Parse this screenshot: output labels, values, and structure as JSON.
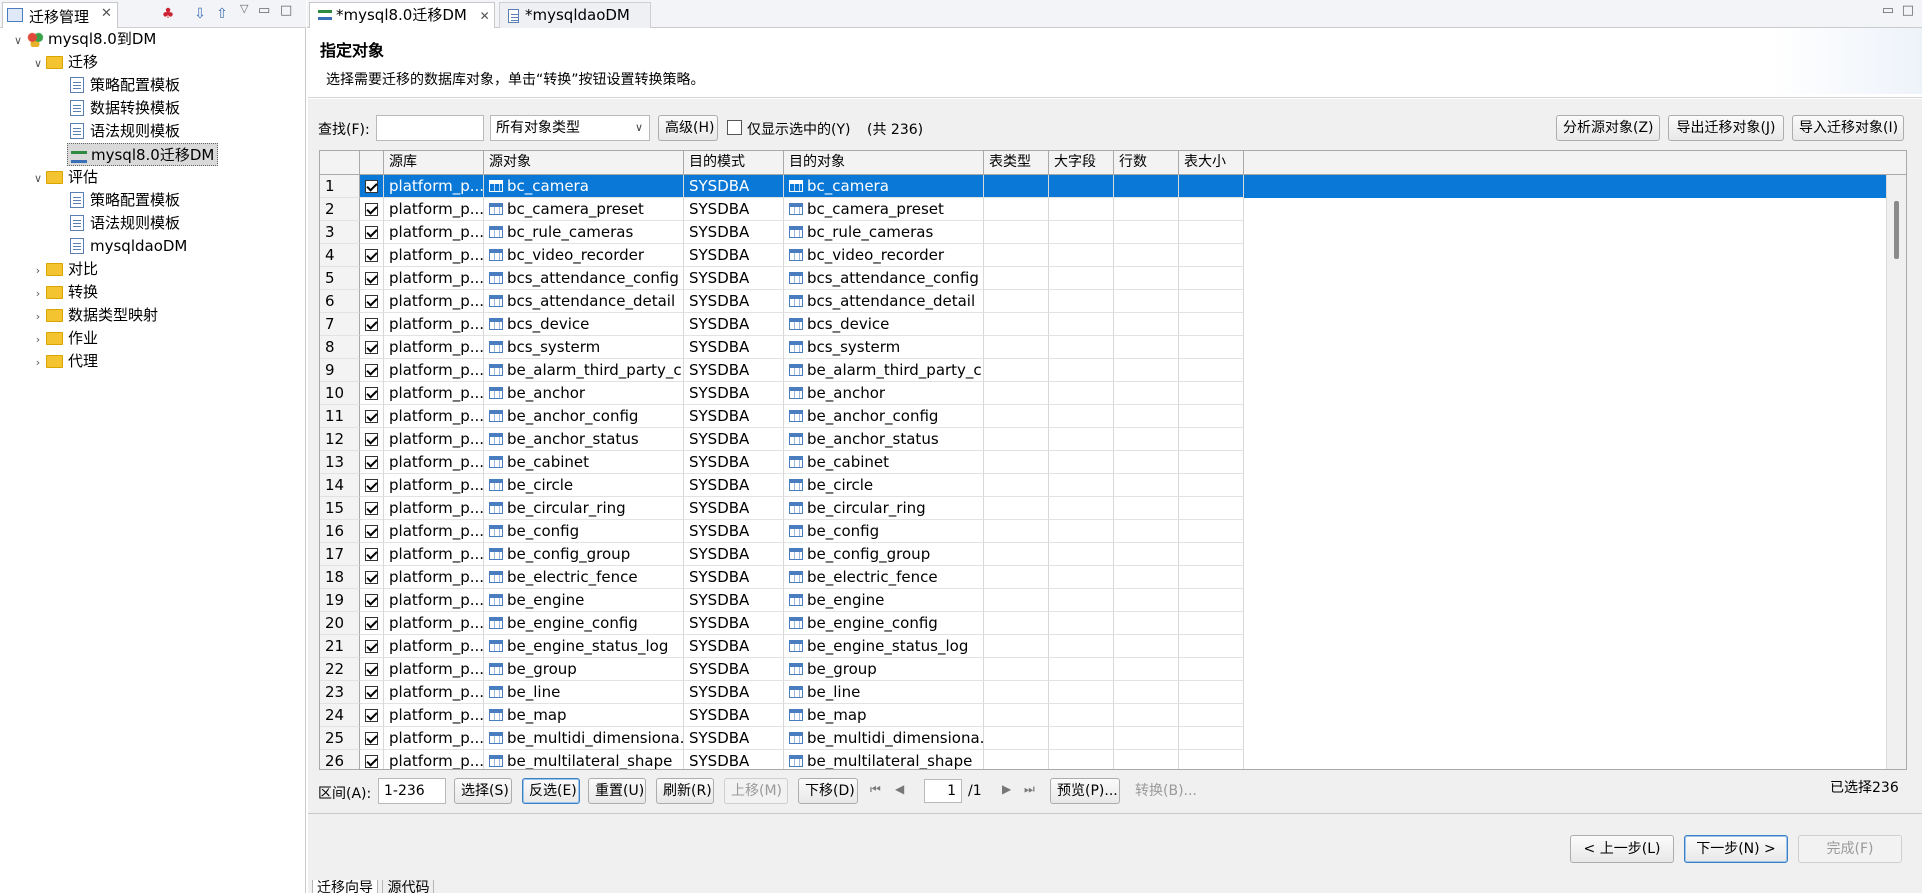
{
  "left_panel": {
    "tab_title": "迁移管理",
    "tree": {
      "root": "mysql8.0到DM",
      "migration_group": "迁移",
      "migration_items": [
        "策略配置模板",
        "数据转换模板",
        "语法规则模板",
        "mysql8.0迁移DM"
      ],
      "evaluation_group": "评估",
      "evaluation_items": [
        "策略配置模板",
        "语法规则模板",
        "mysqldaoDM"
      ],
      "other_groups": [
        "对比",
        "转换",
        "数据类型映射",
        "作业",
        "代理"
      ]
    }
  },
  "editor_tabs": [
    "*mysql8.0迁移DM",
    "*mysqldaoDM"
  ],
  "header": {
    "title": "指定对象",
    "subtitle": "选择需要迁移的数据库对象，单击“转换”按钮设置转换策略。"
  },
  "filter": {
    "find_label": "查找(F):",
    "find_value": "",
    "type_select": "所有对象类型",
    "advanced_button": "高级(H)",
    "only_selected_label": "仅显示选中的(Y)",
    "total": "(共 236)",
    "analyze_button": "分析源对象(Z)",
    "export_button": "导出迁移对象(J)",
    "import_button": "导入迁移对象(I)"
  },
  "table": {
    "columns": [
      "",
      "",
      "源库",
      "源对象",
      "目的模式",
      "目的对象",
      "表类型",
      "大字段",
      "行数",
      "表大小"
    ],
    "rows": [
      {
        "num": "1",
        "src_db": "platform_p...",
        "src_obj": "bc_camera",
        "dst_schema": "SYSDBA",
        "dst_obj": "bc_camera"
      },
      {
        "num": "2",
        "src_db": "platform_p...",
        "src_obj": "bc_camera_preset",
        "dst_schema": "SYSDBA",
        "dst_obj": "bc_camera_preset"
      },
      {
        "num": "3",
        "src_db": "platform_p...",
        "src_obj": "bc_rule_cameras",
        "dst_schema": "SYSDBA",
        "dst_obj": "bc_rule_cameras"
      },
      {
        "num": "4",
        "src_db": "platform_p...",
        "src_obj": "bc_video_recorder",
        "dst_schema": "SYSDBA",
        "dst_obj": "bc_video_recorder"
      },
      {
        "num": "5",
        "src_db": "platform_p...",
        "src_obj": "bcs_attendance_config",
        "dst_schema": "SYSDBA",
        "dst_obj": "bcs_attendance_config"
      },
      {
        "num": "6",
        "src_db": "platform_p...",
        "src_obj": "bcs_attendance_detail",
        "dst_schema": "SYSDBA",
        "dst_obj": "bcs_attendance_detail"
      },
      {
        "num": "7",
        "src_db": "platform_p...",
        "src_obj": "bcs_device",
        "dst_schema": "SYSDBA",
        "dst_obj": "bcs_device"
      },
      {
        "num": "8",
        "src_db": "platform_p...",
        "src_obj": "bcs_systerm",
        "dst_schema": "SYSDBA",
        "dst_obj": "bcs_systerm"
      },
      {
        "num": "9",
        "src_db": "platform_p...",
        "src_obj": "be_alarm_third_party_c...",
        "dst_schema": "SYSDBA",
        "dst_obj": "be_alarm_third_party_c..."
      },
      {
        "num": "10",
        "src_db": "platform_p...",
        "src_obj": "be_anchor",
        "dst_schema": "SYSDBA",
        "dst_obj": "be_anchor"
      },
      {
        "num": "11",
        "src_db": "platform_p...",
        "src_obj": "be_anchor_config",
        "dst_schema": "SYSDBA",
        "dst_obj": "be_anchor_config"
      },
      {
        "num": "12",
        "src_db": "platform_p...",
        "src_obj": "be_anchor_status",
        "dst_schema": "SYSDBA",
        "dst_obj": "be_anchor_status"
      },
      {
        "num": "13",
        "src_db": "platform_p...",
        "src_obj": "be_cabinet",
        "dst_schema": "SYSDBA",
        "dst_obj": "be_cabinet"
      },
      {
        "num": "14",
        "src_db": "platform_p...",
        "src_obj": "be_circle",
        "dst_schema": "SYSDBA",
        "dst_obj": "be_circle"
      },
      {
        "num": "15",
        "src_db": "platform_p...",
        "src_obj": "be_circular_ring",
        "dst_schema": "SYSDBA",
        "dst_obj": "be_circular_ring"
      },
      {
        "num": "16",
        "src_db": "platform_p...",
        "src_obj": "be_config",
        "dst_schema": "SYSDBA",
        "dst_obj": "be_config"
      },
      {
        "num": "17",
        "src_db": "platform_p...",
        "src_obj": "be_config_group",
        "dst_schema": "SYSDBA",
        "dst_obj": "be_config_group"
      },
      {
        "num": "18",
        "src_db": "platform_p...",
        "src_obj": "be_electric_fence",
        "dst_schema": "SYSDBA",
        "dst_obj": "be_electric_fence"
      },
      {
        "num": "19",
        "src_db": "platform_p...",
        "src_obj": "be_engine",
        "dst_schema": "SYSDBA",
        "dst_obj": "be_engine"
      },
      {
        "num": "20",
        "src_db": "platform_p...",
        "src_obj": "be_engine_config",
        "dst_schema": "SYSDBA",
        "dst_obj": "be_engine_config"
      },
      {
        "num": "21",
        "src_db": "platform_p...",
        "src_obj": "be_engine_status_log",
        "dst_schema": "SYSDBA",
        "dst_obj": "be_engine_status_log"
      },
      {
        "num": "22",
        "src_db": "platform_p...",
        "src_obj": "be_group",
        "dst_schema": "SYSDBA",
        "dst_obj": "be_group"
      },
      {
        "num": "23",
        "src_db": "platform_p...",
        "src_obj": "be_line",
        "dst_schema": "SYSDBA",
        "dst_obj": "be_line"
      },
      {
        "num": "24",
        "src_db": "platform_p...",
        "src_obj": "be_map",
        "dst_schema": "SYSDBA",
        "dst_obj": "be_map"
      },
      {
        "num": "25",
        "src_db": "platform_p...",
        "src_obj": "be_multidi_dimensiona...",
        "dst_schema": "SYSDBA",
        "dst_obj": "be_multidi_dimensiona..."
      },
      {
        "num": "26",
        "src_db": "platform_p...",
        "src_obj": "be_multilateral_shape",
        "dst_schema": "SYSDBA",
        "dst_obj": "be_multilateral_shape"
      }
    ],
    "selected_row": 0
  },
  "bottom_bar": {
    "range_label": "区间(A):",
    "range_value": "1-236",
    "select_button": "选择(S)",
    "invert_button": "反选(E)",
    "reset_button": "重置(U)",
    "refresh_button": "刷新(R)",
    "up_button": "上移(M)",
    "down_button": "下移(D)",
    "page_value": "1",
    "page_total": "/1",
    "preview_button": "预览(P)...",
    "convert_button": "转换(B)...",
    "selected_count": "已选择236"
  },
  "wizard": {
    "prev_button": "< 上一步(L)",
    "next_button": "下一步(N) >",
    "finish_button": "完成(F)"
  },
  "bottom_tabs": [
    "迁移向导",
    "源代码"
  ],
  "colors": {
    "selection": "#0a78d7",
    "accent": "#3b7fc4"
  }
}
